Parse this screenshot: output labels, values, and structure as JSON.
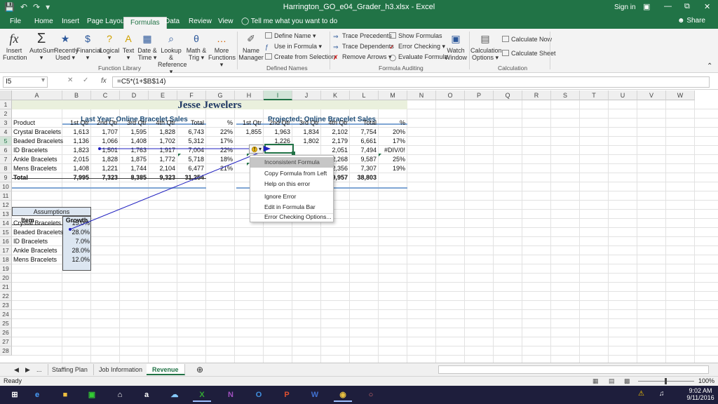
{
  "titlebar": {
    "title": "Harrington_GO_e04_Grader_h3.xlsx - Excel",
    "sign_in": "Sign in",
    "save_icon": "save-icon",
    "undo_icon": "undo-icon",
    "redo_icon": "redo-icon",
    "minimize": "—",
    "restore": "⧉",
    "close": "✕"
  },
  "menu": {
    "tabs": [
      "File",
      "Home",
      "Insert",
      "Page Layout",
      "Formulas",
      "Data",
      "Review",
      "View"
    ],
    "active": "Formulas",
    "tell_me": "Tell me what you want to do",
    "share": "Share"
  },
  "ribbon": {
    "buttons": [
      {
        "label1": "Insert",
        "label2": "Function",
        "icon": "fx"
      },
      {
        "label1": "AutoSum",
        "label2": "▾",
        "icon": "Σ"
      },
      {
        "label1": "Recently",
        "label2": "Used ▾",
        "icon": "★"
      },
      {
        "label1": "Financial",
        "label2": "▾",
        "icon": "$"
      },
      {
        "label1": "Logical",
        "label2": "▾",
        "icon": "?"
      },
      {
        "label1": "Text",
        "label2": "▾",
        "icon": "A"
      },
      {
        "label1": "Date &",
        "label2": "Time ▾",
        "icon": "▦"
      },
      {
        "label1": "Lookup &",
        "label2": "Reference ▾",
        "icon": "⌕"
      },
      {
        "label1": "Math &",
        "label2": "Trig ▾",
        "icon": "θ"
      },
      {
        "label1": "More",
        "label2": "Functions ▾",
        "icon": "…"
      },
      {
        "label1": "Name",
        "label2": "Manager",
        "icon": "✐"
      },
      {
        "label1": "Watch",
        "label2": "Window",
        "icon": "▣"
      },
      {
        "label1": "Calculation",
        "label2": "Options ▾",
        "icon": "▤"
      }
    ],
    "define_name": "Define Name ▾",
    "use_in_formula": "Use in Formula ▾",
    "create_from_selection": "Create from Selection",
    "trace_precedents": "Trace Precedents",
    "trace_dependents": "Trace Dependents",
    "remove_arrows": "Remove Arrows ▾",
    "show_formulas": "Show Formulas",
    "error_checking": "Error Checking ▾",
    "evaluate_formula": "Evaluate Formula",
    "calculate_now": "Calculate Now",
    "calculate_sheet": "Calculate Sheet",
    "groups": [
      "Function Library",
      "Defined Names",
      "Formula Auditing",
      "Calculation"
    ]
  },
  "formula_bar": {
    "name_box": "I5",
    "formula": "=C5*(1+$B$14)",
    "fx": "fx",
    "cancel": "✕",
    "enter": "✓"
  },
  "columns": [
    "A",
    "B",
    "C",
    "D",
    "E",
    "F",
    "G",
    "H",
    "I",
    "J",
    "K",
    "L",
    "M",
    "N",
    "O",
    "P",
    "Q",
    "R",
    "S",
    "T",
    "U",
    "V",
    "W"
  ],
  "selected_column": "I",
  "selected_row": "5",
  "rows": [
    "1",
    "2",
    "3",
    "4",
    "5",
    "6",
    "7",
    "8",
    "9",
    "10",
    "11",
    "12",
    "13",
    "14",
    "15",
    "16",
    "17",
    "18",
    "19",
    "20",
    "21",
    "22",
    "23",
    "24",
    "25",
    "26",
    "27",
    "28"
  ],
  "sheet": {
    "title": "Jesse Jewelers",
    "last_year_header": "Last Year: Online Bracelet Sales",
    "projected_header": "Projected: Online Bracelet Sales",
    "headers": [
      "Product",
      "1st Qtr",
      "2nd Qtr",
      "3rd Qtr",
      "4th Qtr",
      "Total",
      "%",
      "1st Qtr",
      "2nd Qtr",
      "3rd Qtr",
      "4th Qtr",
      "Total",
      "%"
    ],
    "data_rows": [
      {
        "name": "Crystal Bracelets",
        "b": "1,613",
        "c": "1,707",
        "d": "1,595",
        "e": "1,828",
        "f": "6,743",
        "g": "22%",
        "h": "1,855",
        "i": "1,963",
        "j": "1,834",
        "k": "2,102",
        "l": "7,754",
        "m": "20%"
      },
      {
        "name": "Beaded Bracelets",
        "b": "1,136",
        "c": "1,066",
        "d": "1,408",
        "e": "1,702",
        "f": "5,312",
        "g": "17%",
        "h": "",
        "i": "1,226",
        "j": "1,802",
        "k": "2,179",
        "l": "6,661",
        "m": "17%"
      },
      {
        "name": "ID Bracelets",
        "b": "1,823",
        "c": "1,501",
        "d": "1,763",
        "e": "1,917",
        "f": "7,004",
        "g": "22%",
        "h": "",
        "i": "",
        "j": "",
        "k": "2,051",
        "l": "7,494",
        "m": "#DIV/0!"
      },
      {
        "name": "Ankle Bracelets",
        "b": "2,015",
        "c": "1,828",
        "d": "1,875",
        "e": "1,772",
        "f": "5,718",
        "g": "18%",
        "h": "2",
        "i": "",
        "j": "",
        "k": "2,268",
        "l": "9,587",
        "m": "25%"
      },
      {
        "name": "Mens Bracelets",
        "b": "1,408",
        "c": "1,221",
        "d": "1,744",
        "e": "2,104",
        "f": "6,477",
        "g": "21%",
        "h": "1",
        "i": "",
        "j": "",
        "k": "2,356",
        "l": "7,307",
        "m": "19%"
      },
      {
        "name": "Total",
        "b": "7,995",
        "c": "7,323",
        "d": "8,385",
        "e": "9,323",
        "f": "31,254",
        "g": "",
        "h": "9",
        "i": "",
        "j": "",
        "k": "9,957",
        "l": "38,803",
        "m": ""
      }
    ],
    "assumptions_title": "Assumptions",
    "assumptions_item": "Item",
    "assumptions_growth": "Growth",
    "assumptions": [
      {
        "item": "Crystal Bracelets",
        "growth": "15.0%"
      },
      {
        "item": "Beaded Bracelets",
        "growth": "28.0%"
      },
      {
        "item": "ID Bracelets",
        "growth": "7.0%"
      },
      {
        "item": "Ankle Bracelets",
        "growth": "28.0%"
      },
      {
        "item": "Mens Bracelets",
        "growth": "12.0%"
      }
    ]
  },
  "error_menu": {
    "items": [
      "Inconsistent Formula",
      "Copy Formula from Left",
      "Help on this error",
      "Ignore Error",
      "Edit in Formula Bar",
      "Error Checking Options..."
    ],
    "highlighted": "Inconsistent Formula"
  },
  "sheet_tabs": {
    "ellipsis": "...",
    "tabs": [
      "Staffing Plan",
      "Job Information",
      "Revenue"
    ],
    "active": "Revenue",
    "add": "⊕"
  },
  "status": {
    "left": "Ready",
    "zoom": "100%"
  },
  "taskbar": {
    "time": "9:02 AM",
    "date": "9/11/2016",
    "apps": [
      "Internet Explorer",
      "File Explorer",
      "Store",
      "Home",
      "Amazon",
      "OneDrive",
      "Excel",
      "OneNote",
      "Outlook",
      "PowerPoint",
      "Word",
      "Chrome",
      "Paint"
    ]
  },
  "colors": {
    "excel_green": "#217346",
    "title_fill": "#eaf0dd",
    "header_blue": "#1f4e79",
    "assump_fill": "#dce6f1",
    "arrow_blue": "#2020c0"
  }
}
